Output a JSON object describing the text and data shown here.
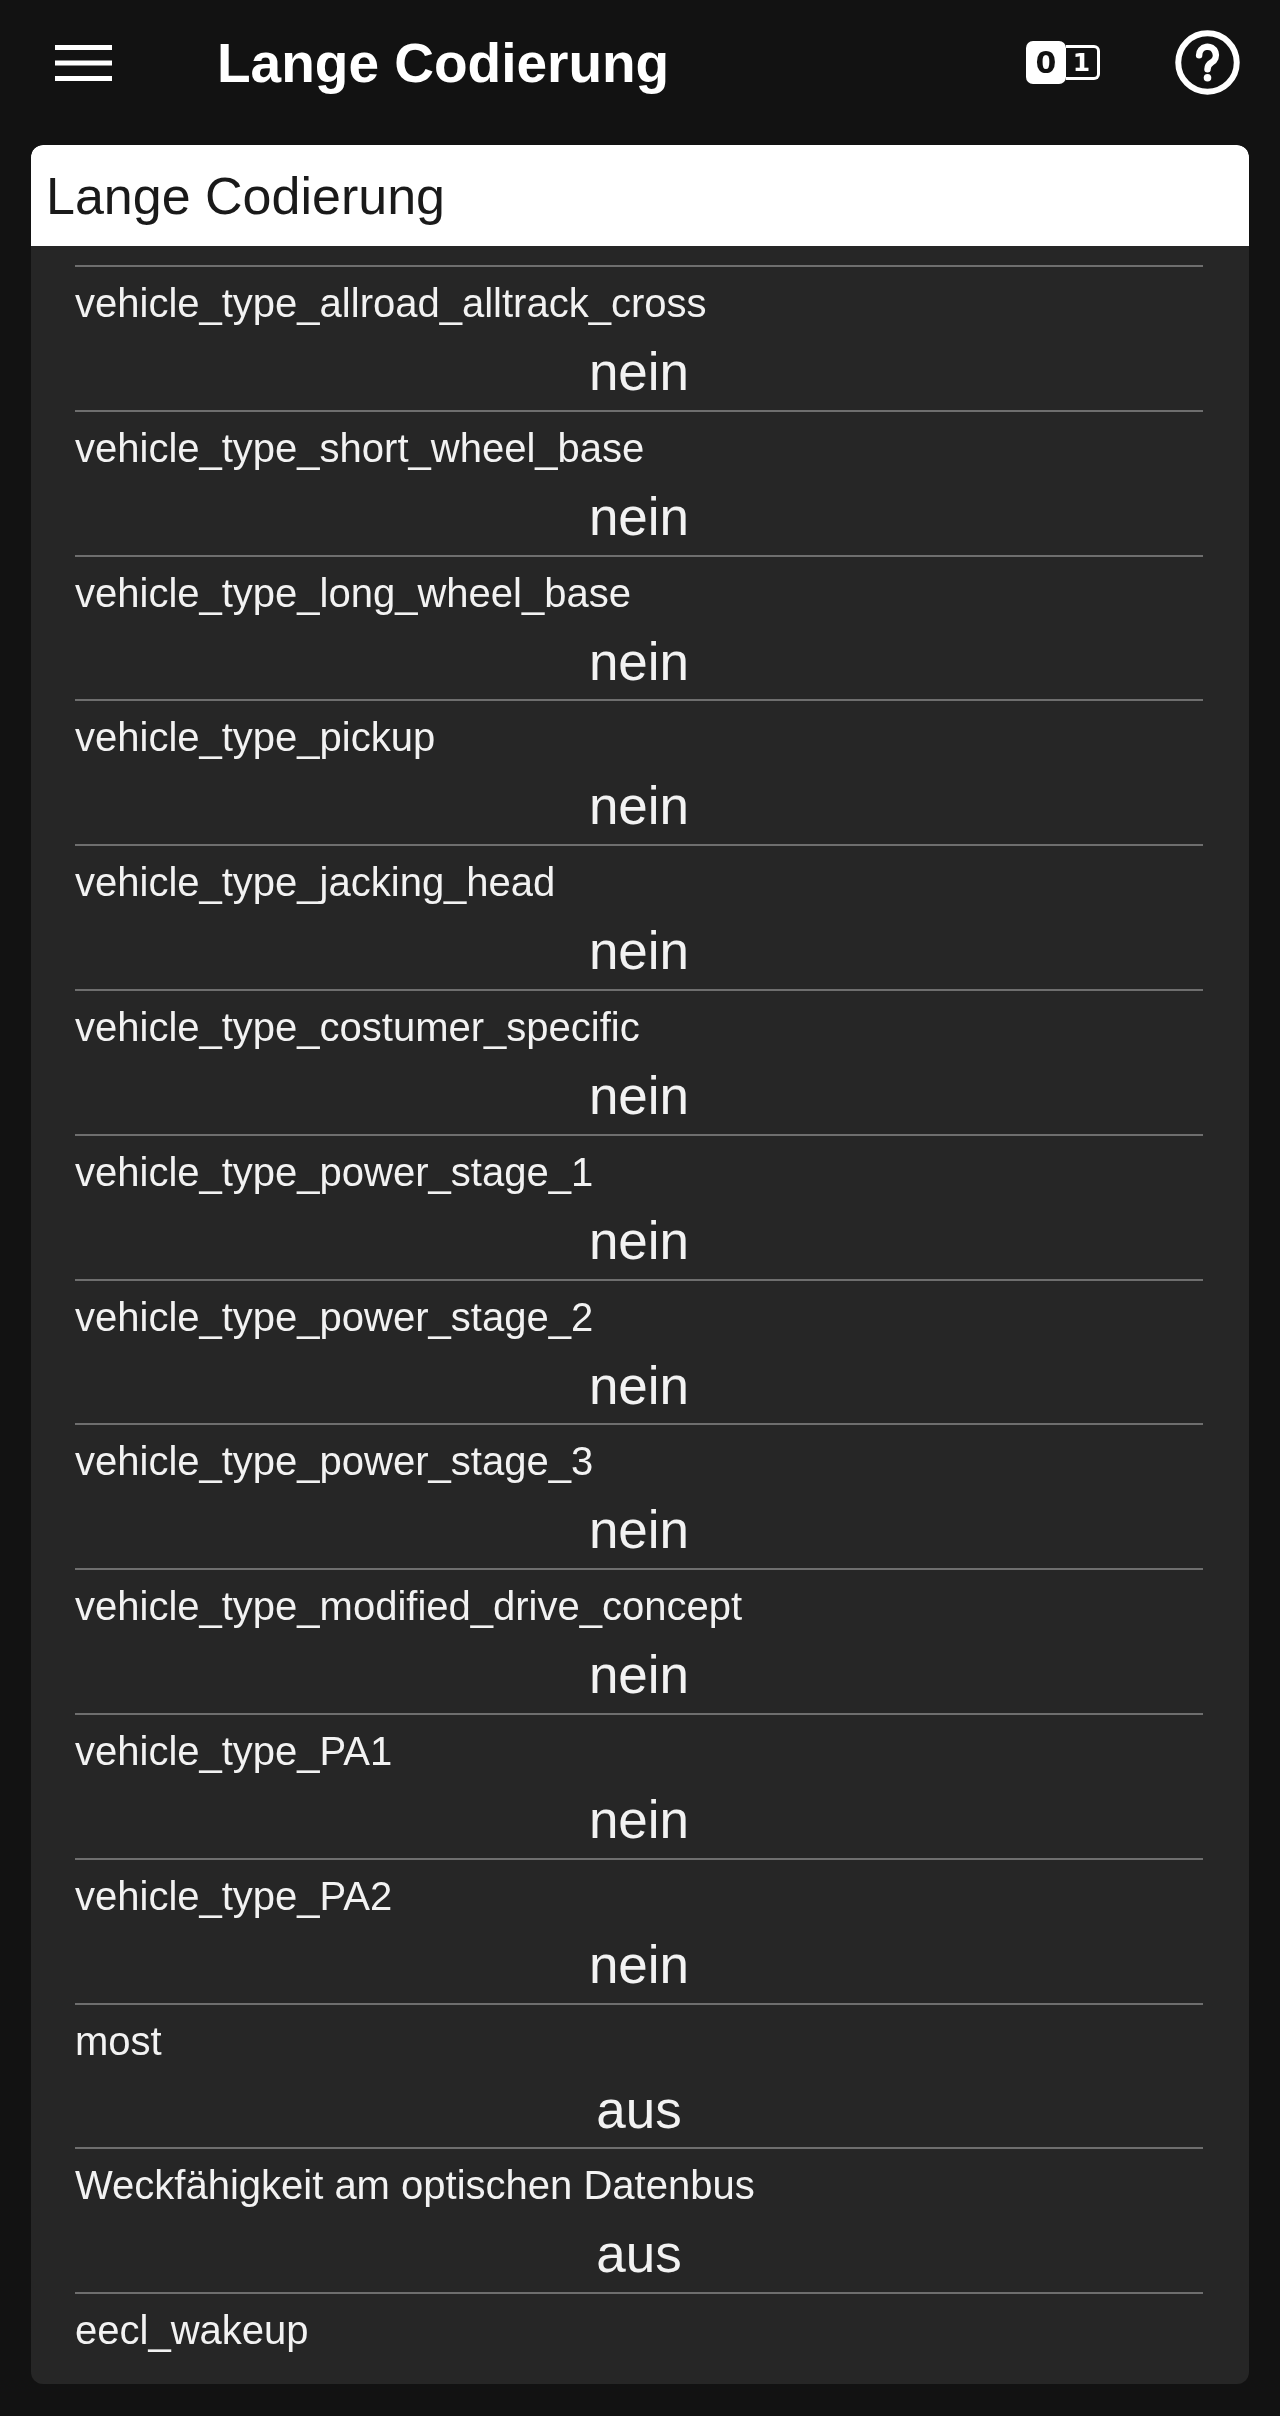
{
  "app_bar": {
    "title": "Lange Codierung",
    "mode_toggle": [
      "0",
      "1"
    ]
  },
  "panel": {
    "title": "Lange Codierung",
    "parameters": [
      {
        "parameter": "vehicle_type_allroad_alltrack_cross",
        "setting": "nein"
      },
      {
        "parameter": "vehicle_type_short_wheel_base",
        "setting": "nein"
      },
      {
        "parameter": "vehicle_type_long_wheel_base",
        "setting": "nein"
      },
      {
        "parameter": "vehicle_type_pickup",
        "setting": "nein"
      },
      {
        "parameter": "vehicle_type_jacking_head",
        "setting": "nein"
      },
      {
        "parameter": "vehicle_type_costumer_specific",
        "setting": "nein"
      },
      {
        "parameter": "vehicle_type_power_stage_1",
        "setting": "nein"
      },
      {
        "parameter": "vehicle_type_power_stage_2",
        "setting": "nein"
      },
      {
        "parameter": "vehicle_type_power_stage_3",
        "setting": "nein"
      },
      {
        "parameter": "vehicle_type_modified_drive_concept",
        "setting": "nein"
      },
      {
        "parameter": "vehicle_type_PA1",
        "setting": "nein"
      },
      {
        "parameter": "vehicle_type_PA2",
        "setting": "nein"
      },
      {
        "parameter": "most",
        "setting": "aus"
      },
      {
        "parameter": "Weckfähigkeit am optischen Datenbus",
        "setting": "aus"
      },
      {
        "parameter": "eecl_wakeup"
      }
    ]
  }
}
